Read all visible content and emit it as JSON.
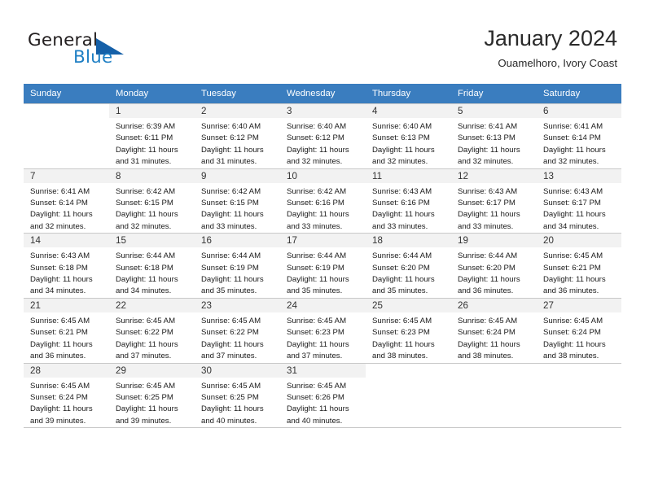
{
  "brand": {
    "name_part1": "General",
    "name_part2": "Blue",
    "accent_color": "#1560a8",
    "text_color": "#231f20"
  },
  "header": {
    "title": "January 2024",
    "subtitle": "Ouamelhoro, Ivory Coast"
  },
  "theme": {
    "header_row_bg": "#3a7dbf",
    "header_row_text": "#ffffff",
    "daynum_bg": "#f2f2f2",
    "grid_line": "#c8c8c8"
  },
  "weekdays": [
    "Sunday",
    "Monday",
    "Tuesday",
    "Wednesday",
    "Thursday",
    "Friday",
    "Saturday"
  ],
  "weeks": [
    [
      {
        "day": "",
        "lines": []
      },
      {
        "day": "1",
        "lines": [
          "Sunrise: 6:39 AM",
          "Sunset: 6:11 PM",
          "Daylight: 11 hours",
          "and 31 minutes."
        ]
      },
      {
        "day": "2",
        "lines": [
          "Sunrise: 6:40 AM",
          "Sunset: 6:12 PM",
          "Daylight: 11 hours",
          "and 31 minutes."
        ]
      },
      {
        "day": "3",
        "lines": [
          "Sunrise: 6:40 AM",
          "Sunset: 6:12 PM",
          "Daylight: 11 hours",
          "and 32 minutes."
        ]
      },
      {
        "day": "4",
        "lines": [
          "Sunrise: 6:40 AM",
          "Sunset: 6:13 PM",
          "Daylight: 11 hours",
          "and 32 minutes."
        ]
      },
      {
        "day": "5",
        "lines": [
          "Sunrise: 6:41 AM",
          "Sunset: 6:13 PM",
          "Daylight: 11 hours",
          "and 32 minutes."
        ]
      },
      {
        "day": "6",
        "lines": [
          "Sunrise: 6:41 AM",
          "Sunset: 6:14 PM",
          "Daylight: 11 hours",
          "and 32 minutes."
        ]
      }
    ],
    [
      {
        "day": "7",
        "lines": [
          "Sunrise: 6:41 AM",
          "Sunset: 6:14 PM",
          "Daylight: 11 hours",
          "and 32 minutes."
        ]
      },
      {
        "day": "8",
        "lines": [
          "Sunrise: 6:42 AM",
          "Sunset: 6:15 PM",
          "Daylight: 11 hours",
          "and 32 minutes."
        ]
      },
      {
        "day": "9",
        "lines": [
          "Sunrise: 6:42 AM",
          "Sunset: 6:15 PM",
          "Daylight: 11 hours",
          "and 33 minutes."
        ]
      },
      {
        "day": "10",
        "lines": [
          "Sunrise: 6:42 AM",
          "Sunset: 6:16 PM",
          "Daylight: 11 hours",
          "and 33 minutes."
        ]
      },
      {
        "day": "11",
        "lines": [
          "Sunrise: 6:43 AM",
          "Sunset: 6:16 PM",
          "Daylight: 11 hours",
          "and 33 minutes."
        ]
      },
      {
        "day": "12",
        "lines": [
          "Sunrise: 6:43 AM",
          "Sunset: 6:17 PM",
          "Daylight: 11 hours",
          "and 33 minutes."
        ]
      },
      {
        "day": "13",
        "lines": [
          "Sunrise: 6:43 AM",
          "Sunset: 6:17 PM",
          "Daylight: 11 hours",
          "and 34 minutes."
        ]
      }
    ],
    [
      {
        "day": "14",
        "lines": [
          "Sunrise: 6:43 AM",
          "Sunset: 6:18 PM",
          "Daylight: 11 hours",
          "and 34 minutes."
        ]
      },
      {
        "day": "15",
        "lines": [
          "Sunrise: 6:44 AM",
          "Sunset: 6:18 PM",
          "Daylight: 11 hours",
          "and 34 minutes."
        ]
      },
      {
        "day": "16",
        "lines": [
          "Sunrise: 6:44 AM",
          "Sunset: 6:19 PM",
          "Daylight: 11 hours",
          "and 35 minutes."
        ]
      },
      {
        "day": "17",
        "lines": [
          "Sunrise: 6:44 AM",
          "Sunset: 6:19 PM",
          "Daylight: 11 hours",
          "and 35 minutes."
        ]
      },
      {
        "day": "18",
        "lines": [
          "Sunrise: 6:44 AM",
          "Sunset: 6:20 PM",
          "Daylight: 11 hours",
          "and 35 minutes."
        ]
      },
      {
        "day": "19",
        "lines": [
          "Sunrise: 6:44 AM",
          "Sunset: 6:20 PM",
          "Daylight: 11 hours",
          "and 36 minutes."
        ]
      },
      {
        "day": "20",
        "lines": [
          "Sunrise: 6:45 AM",
          "Sunset: 6:21 PM",
          "Daylight: 11 hours",
          "and 36 minutes."
        ]
      }
    ],
    [
      {
        "day": "21",
        "lines": [
          "Sunrise: 6:45 AM",
          "Sunset: 6:21 PM",
          "Daylight: 11 hours",
          "and 36 minutes."
        ]
      },
      {
        "day": "22",
        "lines": [
          "Sunrise: 6:45 AM",
          "Sunset: 6:22 PM",
          "Daylight: 11 hours",
          "and 37 minutes."
        ]
      },
      {
        "day": "23",
        "lines": [
          "Sunrise: 6:45 AM",
          "Sunset: 6:22 PM",
          "Daylight: 11 hours",
          "and 37 minutes."
        ]
      },
      {
        "day": "24",
        "lines": [
          "Sunrise: 6:45 AM",
          "Sunset: 6:23 PM",
          "Daylight: 11 hours",
          "and 37 minutes."
        ]
      },
      {
        "day": "25",
        "lines": [
          "Sunrise: 6:45 AM",
          "Sunset: 6:23 PM",
          "Daylight: 11 hours",
          "and 38 minutes."
        ]
      },
      {
        "day": "26",
        "lines": [
          "Sunrise: 6:45 AM",
          "Sunset: 6:24 PM",
          "Daylight: 11 hours",
          "and 38 minutes."
        ]
      },
      {
        "day": "27",
        "lines": [
          "Sunrise: 6:45 AM",
          "Sunset: 6:24 PM",
          "Daylight: 11 hours",
          "and 38 minutes."
        ]
      }
    ],
    [
      {
        "day": "28",
        "lines": [
          "Sunrise: 6:45 AM",
          "Sunset: 6:24 PM",
          "Daylight: 11 hours",
          "and 39 minutes."
        ]
      },
      {
        "day": "29",
        "lines": [
          "Sunrise: 6:45 AM",
          "Sunset: 6:25 PM",
          "Daylight: 11 hours",
          "and 39 minutes."
        ]
      },
      {
        "day": "30",
        "lines": [
          "Sunrise: 6:45 AM",
          "Sunset: 6:25 PM",
          "Daylight: 11 hours",
          "and 40 minutes."
        ]
      },
      {
        "day": "31",
        "lines": [
          "Sunrise: 6:45 AM",
          "Sunset: 6:26 PM",
          "Daylight: 11 hours",
          "and 40 minutes."
        ]
      },
      {
        "day": "",
        "lines": []
      },
      {
        "day": "",
        "lines": []
      },
      {
        "day": "",
        "lines": []
      }
    ]
  ]
}
